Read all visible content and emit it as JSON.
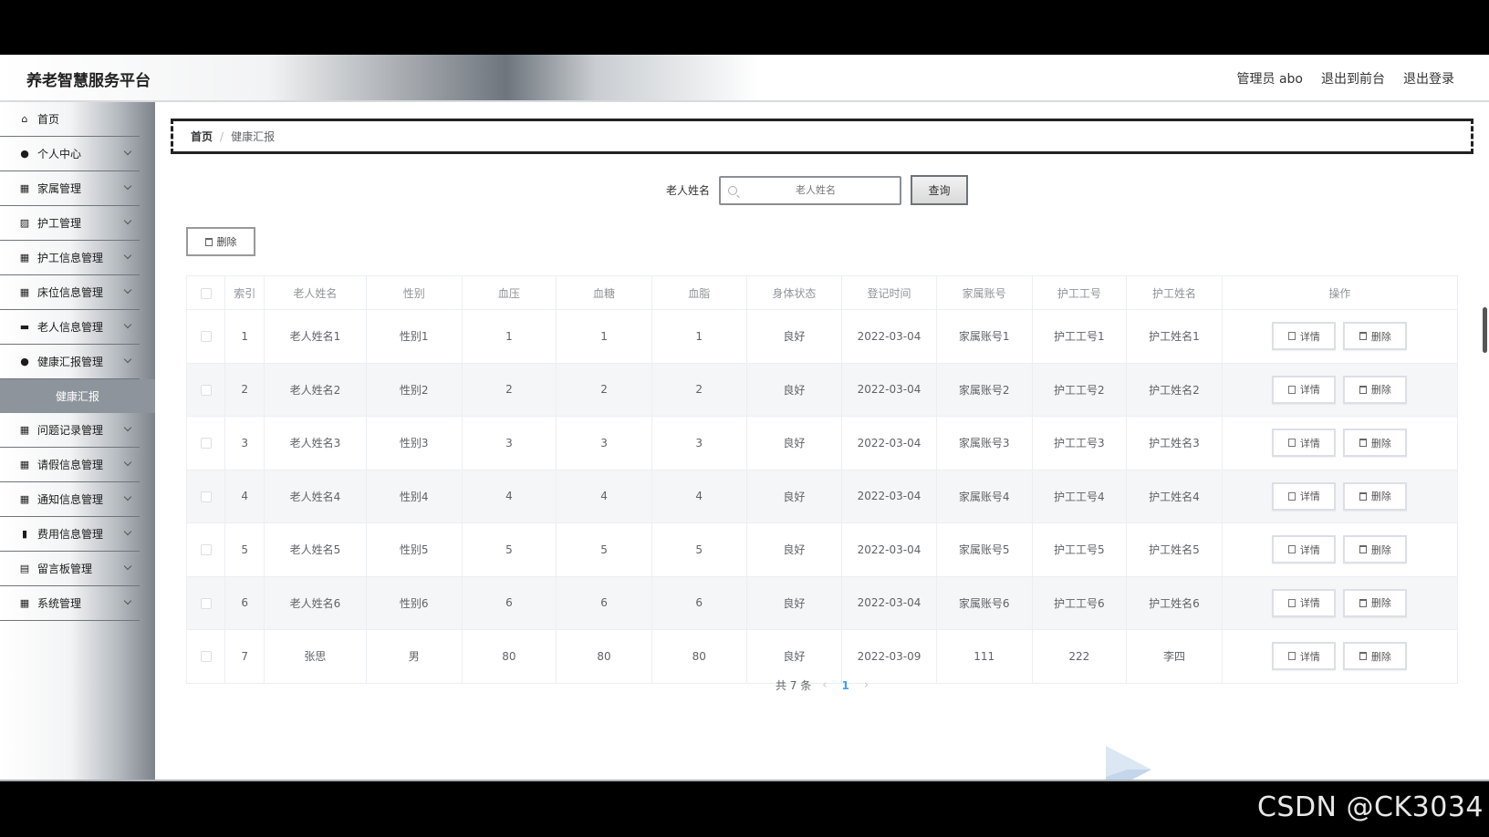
{
  "app": {
    "title": "养老智慧服务平台",
    "header_right": {
      "admin": "管理员 abo",
      "front": "退出到前台",
      "logout": "退出登录"
    }
  },
  "sidebar": {
    "items": [
      {
        "label": "首页",
        "icon": "home-icon"
      },
      {
        "label": "个人中心",
        "icon": "user-icon"
      },
      {
        "label": "家属管理",
        "icon": "grid-icon"
      },
      {
        "label": "护工管理",
        "icon": "chart-icon"
      },
      {
        "label": "护工信息管理",
        "icon": "grid-icon"
      },
      {
        "label": "床位信息管理",
        "icon": "grid-icon"
      },
      {
        "label": "老人信息管理",
        "icon": "card-icon"
      },
      {
        "label": "健康汇报管理",
        "icon": "user-icon"
      }
    ],
    "active_sub": "健康汇报",
    "items_after": [
      {
        "label": "问题记录管理",
        "icon": "grid-icon"
      },
      {
        "label": "请假信息管理",
        "icon": "grid-icon"
      },
      {
        "label": "通知信息管理",
        "icon": "grid9-icon"
      },
      {
        "label": "费用信息管理",
        "icon": "bar-chart-icon"
      },
      {
        "label": "留言板管理",
        "icon": "briefcase-icon"
      },
      {
        "label": "系统管理",
        "icon": "grid-icon"
      }
    ]
  },
  "breadcrumb": {
    "home": "首页",
    "sep": "/",
    "current": "健康汇报"
  },
  "search": {
    "label": "老人姓名",
    "placeholder": "老人姓名",
    "button": "查询"
  },
  "toolbar": {
    "delete_label": "删除"
  },
  "table": {
    "headers": [
      "索引",
      "老人姓名",
      "性别",
      "血压",
      "血糖",
      "血脂",
      "身体状态",
      "登记时间",
      "家属账号",
      "护工工号",
      "护工姓名",
      "操作"
    ],
    "rows": [
      [
        "1",
        "老人姓名1",
        "性别1",
        "1",
        "1",
        "1",
        "良好",
        "2022-03-04",
        "家属账号1",
        "护工工号1",
        "护工姓名1"
      ],
      [
        "2",
        "老人姓名2",
        "性别2",
        "2",
        "2",
        "2",
        "良好",
        "2022-03-04",
        "家属账号2",
        "护工工号2",
        "护工姓名2"
      ],
      [
        "3",
        "老人姓名3",
        "性别3",
        "3",
        "3",
        "3",
        "良好",
        "2022-03-04",
        "家属账号3",
        "护工工号3",
        "护工姓名3"
      ],
      [
        "4",
        "老人姓名4",
        "性别4",
        "4",
        "4",
        "4",
        "良好",
        "2022-03-04",
        "家属账号4",
        "护工工号4",
        "护工姓名4"
      ],
      [
        "5",
        "老人姓名5",
        "性别5",
        "5",
        "5",
        "5",
        "良好",
        "2022-03-04",
        "家属账号5",
        "护工工号5",
        "护工姓名5"
      ],
      [
        "6",
        "老人姓名6",
        "性别6",
        "6",
        "6",
        "6",
        "良好",
        "2022-03-04",
        "家属账号6",
        "护工工号6",
        "护工姓名6"
      ],
      [
        "7",
        "张思",
        "男",
        "80",
        "80",
        "80",
        "良好",
        "2022-03-09",
        "111",
        "222",
        "李四"
      ]
    ],
    "actions": {
      "detail": "详情",
      "delete": "删除"
    }
  },
  "pagination": {
    "total": "共 7 条",
    "prev": "‹",
    "page": "1",
    "next": "›"
  },
  "watermark": "CSDN @CK3034"
}
